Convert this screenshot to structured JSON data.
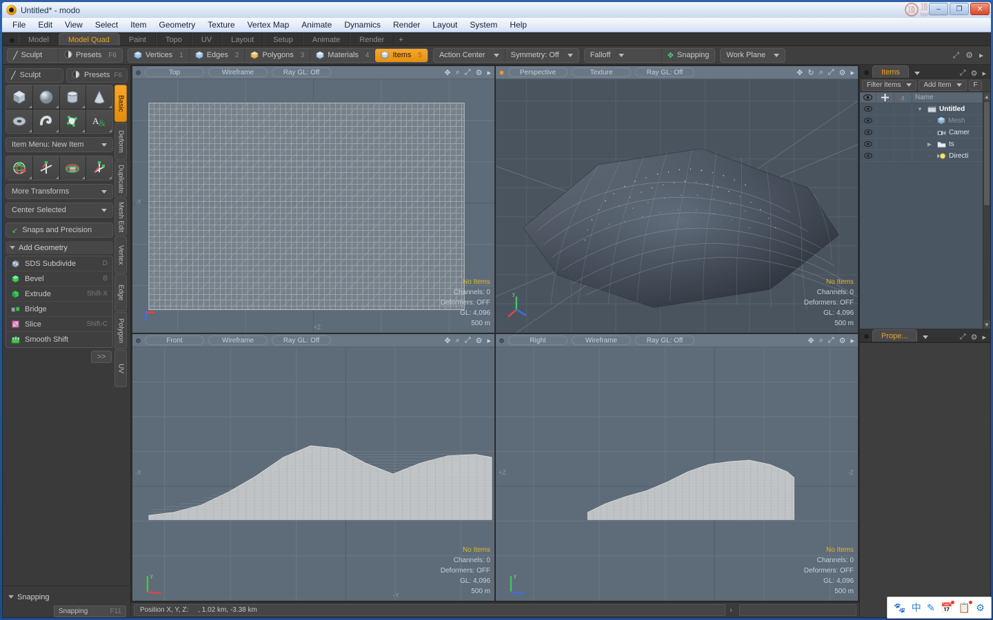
{
  "window": {
    "title": "Untitled* - modo",
    "app_icon": "modo-logo-icon",
    "minimize": "–",
    "maximize": "❐",
    "close": "✕",
    "watermark_ring": "顶",
    "watermark_text": "顶道网",
    "watermark_sub": "topmodo.com"
  },
  "menubar": {
    "items": [
      "File",
      "Edit",
      "View",
      "Select",
      "Item",
      "Geometry",
      "Texture",
      "Vertex Map",
      "Animate",
      "Dynamics",
      "Render",
      "Layout",
      "System",
      "Help"
    ]
  },
  "layout_tabs": {
    "items": [
      "Model",
      "Model Quad",
      "Paint",
      "Topo",
      "UV",
      "Layout",
      "Setup",
      "Animate",
      "Render"
    ],
    "active": "Model Quad",
    "add_label": "+"
  },
  "toolbar": {
    "sculpt": "Sculpt",
    "presets": "Presets",
    "presets_key": "F6",
    "selection_modes": [
      {
        "label": "Vertices",
        "key": "1",
        "active": false
      },
      {
        "label": "Edges",
        "key": "2",
        "active": false
      },
      {
        "label": "Polygons",
        "key": "3",
        "active": false
      },
      {
        "label": "Materials",
        "key": "4",
        "active": false
      },
      {
        "label": "Items",
        "key": "5",
        "active": true
      }
    ],
    "action_center": "Action Center",
    "symmetry": "Symmetry: Off",
    "falloff": "Falloff",
    "snapping": "Snapping",
    "work_plane": "Work Plane",
    "right_icons": [
      "expand-icon",
      "gear-icon",
      "chevron-right-icon"
    ]
  },
  "left_panel": {
    "vertical_tabs": [
      "Basic",
      "Deform",
      "Duplicate",
      "Mesh Edit",
      "Vertex",
      "Edge",
      "Polygon",
      "UV"
    ],
    "vertical_tab_active": "Basic",
    "primitives": [
      "cube-icon",
      "sphere-icon",
      "cylinder-icon",
      "cone-icon",
      "torus-icon",
      "capsule-icon",
      "polygon-pen-icon",
      "text-icon"
    ],
    "item_menu": "Item Menu: New Item",
    "transforms": [
      "transform-move-icon",
      "transform-rotate-icon",
      "transform-scale-icon",
      "transform-all-icon"
    ],
    "more_transforms": "More Transforms",
    "center_selected": "Center Selected",
    "snaps_and_precision": "Snaps and Precision",
    "add_geometry_header": "Add Geometry",
    "geometry_tools": [
      {
        "label": "SDS Subdivide",
        "key": "D",
        "icon": "sds-icon"
      },
      {
        "label": "Bevel",
        "key": "B",
        "icon": "bevel-icon"
      },
      {
        "label": "Extrude",
        "key": "Shift-X",
        "icon": "extrude-icon"
      },
      {
        "label": "Bridge",
        "key": "",
        "icon": "bridge-icon"
      },
      {
        "label": "Slice",
        "key": "Shift-C",
        "icon": "slice-icon"
      },
      {
        "label": "Smooth Shift",
        "key": "",
        "icon": "smooth-shift-icon"
      }
    ],
    "more_button": ">>",
    "snapping_header": "Snapping",
    "snapping_field": "Snapping",
    "snapping_key": "F11"
  },
  "viewports": [
    {
      "name": "top",
      "view": "Top",
      "shading": "Wireframe",
      "raygl": "Ray GL: Off",
      "dot_lit": false,
      "info": {
        "no_items": "No Items",
        "channels": "Channels: 0",
        "deformers": "Deformers: OFF",
        "gl": "GL: 4,096",
        "scale": "500 m"
      },
      "axis_labels": {
        "left": "-X",
        "bottom_right": "+Z"
      }
    },
    {
      "name": "perspective",
      "view": "Perspective",
      "shading": "Texture",
      "raygl": "Ray GL: Off",
      "dot_lit": true,
      "info": {
        "no_items": "No Items",
        "channels": "Channels: 0",
        "deformers": "Deformers: OFF",
        "gl": "GL: 4,096",
        "scale": "500 m"
      },
      "axis_labels": {
        "left": "",
        "bottom_right": ""
      }
    },
    {
      "name": "front",
      "view": "Front",
      "shading": "Wireframe",
      "raygl": "Ray GL: Off",
      "dot_lit": false,
      "info": {
        "no_items": "No Items",
        "channels": "Channels: 0",
        "deformers": "Deformers: OFF",
        "gl": "GL: 4,096",
        "scale": "500 m"
      },
      "axis_labels": {
        "left": "-X",
        "bottom_right": "-Y"
      }
    },
    {
      "name": "right",
      "view": "Right",
      "shading": "Wireframe",
      "raygl": "Ray GL: Off",
      "dot_lit": false,
      "info": {
        "no_items": "No Items",
        "channels": "Channels: 0",
        "deformers": "Deformers: OFF",
        "gl": "GL: 4,096",
        "scale": "500 m"
      },
      "axis_labels": {
        "left": "+Z",
        "bottom_right": "-Z"
      }
    }
  ],
  "statusbar": {
    "position_label": "Position X, Y, Z:",
    "position_value": ", 1.02 km, -3.38 km",
    "arrow": "›"
  },
  "right_panel": {
    "items_tab": "Items",
    "filter_items": "Filter Items",
    "add_item": "Add Item",
    "f_button": "F",
    "columns": [
      "eye-icon",
      "cross-icon",
      "axis-icon",
      "Name"
    ],
    "rows": [
      {
        "name": "Untitled",
        "icon": "scene-icon",
        "indent": 0,
        "expander": "▼",
        "style": "bold"
      },
      {
        "name": "Mesh",
        "icon": "mesh-icon",
        "indent": 1,
        "expander": "·",
        "style": "dim"
      },
      {
        "name": "Camer",
        "icon": "camera-icon",
        "indent": 1,
        "expander": "·",
        "style": "normal"
      },
      {
        "name": "ts",
        "icon": "folder-icon",
        "indent": 1,
        "expander": "▶",
        "style": "normal"
      },
      {
        "name": "Directi",
        "icon": "light-icon",
        "indent": 1,
        "expander": "·",
        "style": "normal"
      }
    ],
    "properties_tab": "Prope..."
  },
  "ime_bar": {
    "icons": [
      "paw-icon",
      "chinese-mode-icon",
      "pen-icon",
      "calendar-icon",
      "notes-icon",
      "settings-icon"
    ],
    "chinese_label": "中"
  },
  "colors": {
    "accent": "#f0a020",
    "viewport_bg": "#5e6b78",
    "panel_bg": "#3a3a3a",
    "info_highlight": "#e3b33f"
  }
}
